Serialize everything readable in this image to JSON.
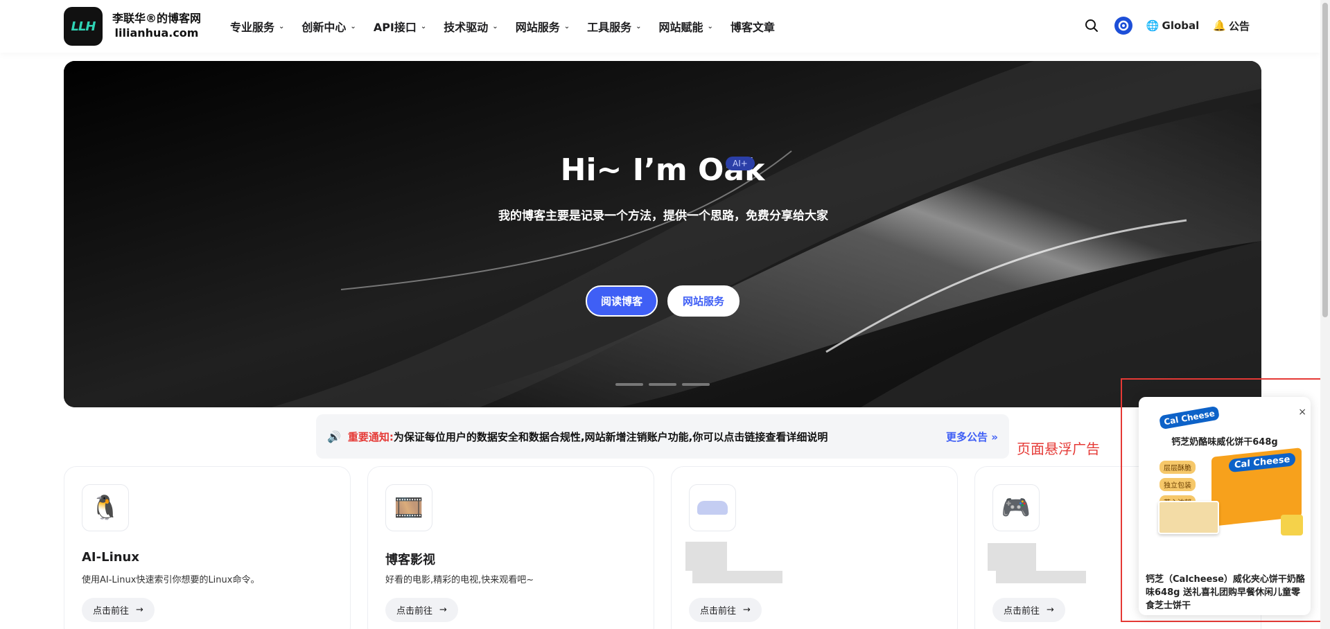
{
  "header": {
    "logo_text": "LLH",
    "brand_title": "李联华®的博客网",
    "brand_domain": "lilianhua.com",
    "nav": [
      {
        "label": "专业服务",
        "dropdown": true
      },
      {
        "label": "创新中心",
        "dropdown": true
      },
      {
        "label": "API接口",
        "dropdown": true
      },
      {
        "label": "技术驱动",
        "dropdown": true
      },
      {
        "label": "网站服务",
        "dropdown": true
      },
      {
        "label": "工具服务",
        "dropdown": true
      },
      {
        "label": "网站赋能",
        "dropdown": true
      },
      {
        "label": "博客文章",
        "dropdown": false
      }
    ],
    "global_label": "Global",
    "announce_label": "公告"
  },
  "hero": {
    "title": "Hi~ I’m Oak",
    "badge": "AI+",
    "subtitle": "我的博客主要是记录一个方法，提供一个思路，免费分享给大家",
    "btn_primary": "阅读博客",
    "btn_secondary": "网站服务",
    "slides": 3
  },
  "notice": {
    "label": "重要通知:",
    "message": "为保证每位用户的数据安全和数据合规性,网站新增注销账户功能,你可以点击链接查看详细说明",
    "more": "更多公告"
  },
  "float_label": "页面悬浮广告",
  "cards": [
    {
      "icon": "penguin-icon",
      "title": "AI-Linux",
      "desc": "使用AI-Linux快速索引你想要的Linux命令。",
      "btn": "点击前往"
    },
    {
      "icon": "film-reel-icon",
      "title": "博客影视",
      "desc": "好看的电影,精彩的电视,快来观看吧~",
      "btn": "点击前往"
    },
    {
      "icon": "cloud-icon",
      "title": "",
      "desc": "",
      "btn": "点击前往"
    },
    {
      "icon": "gamepad-icon",
      "title": "",
      "desc": "",
      "btn": "点击前往"
    }
  ],
  "ad": {
    "brand": "Cal Cheese",
    "headline": "钙芝奶酪味威化饼干648g",
    "tags": [
      "层层酥脆",
      "独立包装",
      "芝心浓郁"
    ],
    "box_label": "Cal Cheese",
    "description": "钙芝（Calcheese）威化夹心饼干奶酪味648g 送礼喜礼团购早餐休闲儿童零食芝士饼干",
    "close": "×"
  },
  "colors": {
    "accent": "#3f5ff5",
    "alert": "#e53935"
  }
}
